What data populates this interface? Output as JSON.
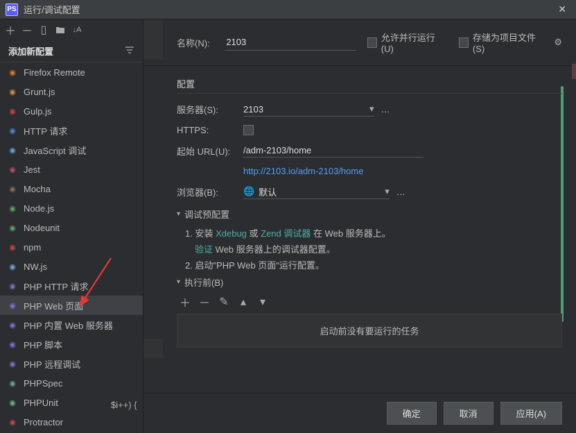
{
  "title": "运行/调试配置",
  "sidebar": {
    "header": "添加新配置",
    "items": [
      {
        "label": "Firefox Remote",
        "color": "#e07a2b"
      },
      {
        "label": "Grunt.js",
        "color": "#d88b3a"
      },
      {
        "label": "Gulp.js",
        "color": "#c24444"
      },
      {
        "label": "HTTP 请求",
        "color": "#4e84c8"
      },
      {
        "label": "JavaScript 调试",
        "color": "#5fa3d8"
      },
      {
        "label": "Jest",
        "color": "#b54d6a"
      },
      {
        "label": "Mocha",
        "color": "#8a6b4a"
      },
      {
        "label": "Node.js",
        "color": "#5fa35f"
      },
      {
        "label": "Nodeunit",
        "color": "#5fa35f"
      },
      {
        "label": "npm",
        "color": "#c24444"
      },
      {
        "label": "NW.js",
        "color": "#6aa5db"
      },
      {
        "label": "PHP HTTP 请求",
        "color": "#7a6fcf"
      },
      {
        "label": "PHP Web 页面",
        "color": "#7a6fcf"
      },
      {
        "label": "PHP 内置 Web 服务器",
        "color": "#7a6fcf"
      },
      {
        "label": "PHP 脚本",
        "color": "#7a6fcf"
      },
      {
        "label": "PHP 远程调试",
        "color": "#7a6fcf"
      },
      {
        "label": "PHPSpec",
        "color": "#6aa0a0"
      },
      {
        "label": "PHPUnit",
        "color": "#6ab08a"
      },
      {
        "label": "Protractor",
        "color": "#c24444"
      }
    ],
    "selectedIndex": 12
  },
  "form": {
    "name_label": "名称(N):",
    "name_value": "2103",
    "allow_parallel": "允许并行运行(U)",
    "store_as_project": "存储为项目文件(S)",
    "config_section": "配置",
    "server_label": "服务器(S):",
    "server_value": "2103",
    "https_label": "HTTPS:",
    "start_url_label": "起始 URL(U):",
    "start_url_value": "/adm-2103/home",
    "resolved_url": "http://2103.io/adm-2103/home",
    "browser_label": "浏览器(B):",
    "browser_value": "默认",
    "debug_pre_title": "调试预配置",
    "debug_step1_pre": "1. 安装 ",
    "debug_step1_x": "Xdebug",
    "debug_step1_or": " 或 ",
    "debug_step1_z": "Zend 调试器",
    "debug_step1_post": " 在 Web 服务器上。",
    "debug_step1b_a": "验证",
    "debug_step1b_t": " Web 服务器上的调试器配置。",
    "debug_step2": "2. 启动\"PHP Web 页面\"运行配置。",
    "before_launch_title": "执行前(B)",
    "before_launch_empty": "启动前没有要运行的任务"
  },
  "buttons": {
    "ok": "确定",
    "cancel": "取消",
    "apply": "应用(A)"
  },
  "codeSnippet": "$i++) {"
}
